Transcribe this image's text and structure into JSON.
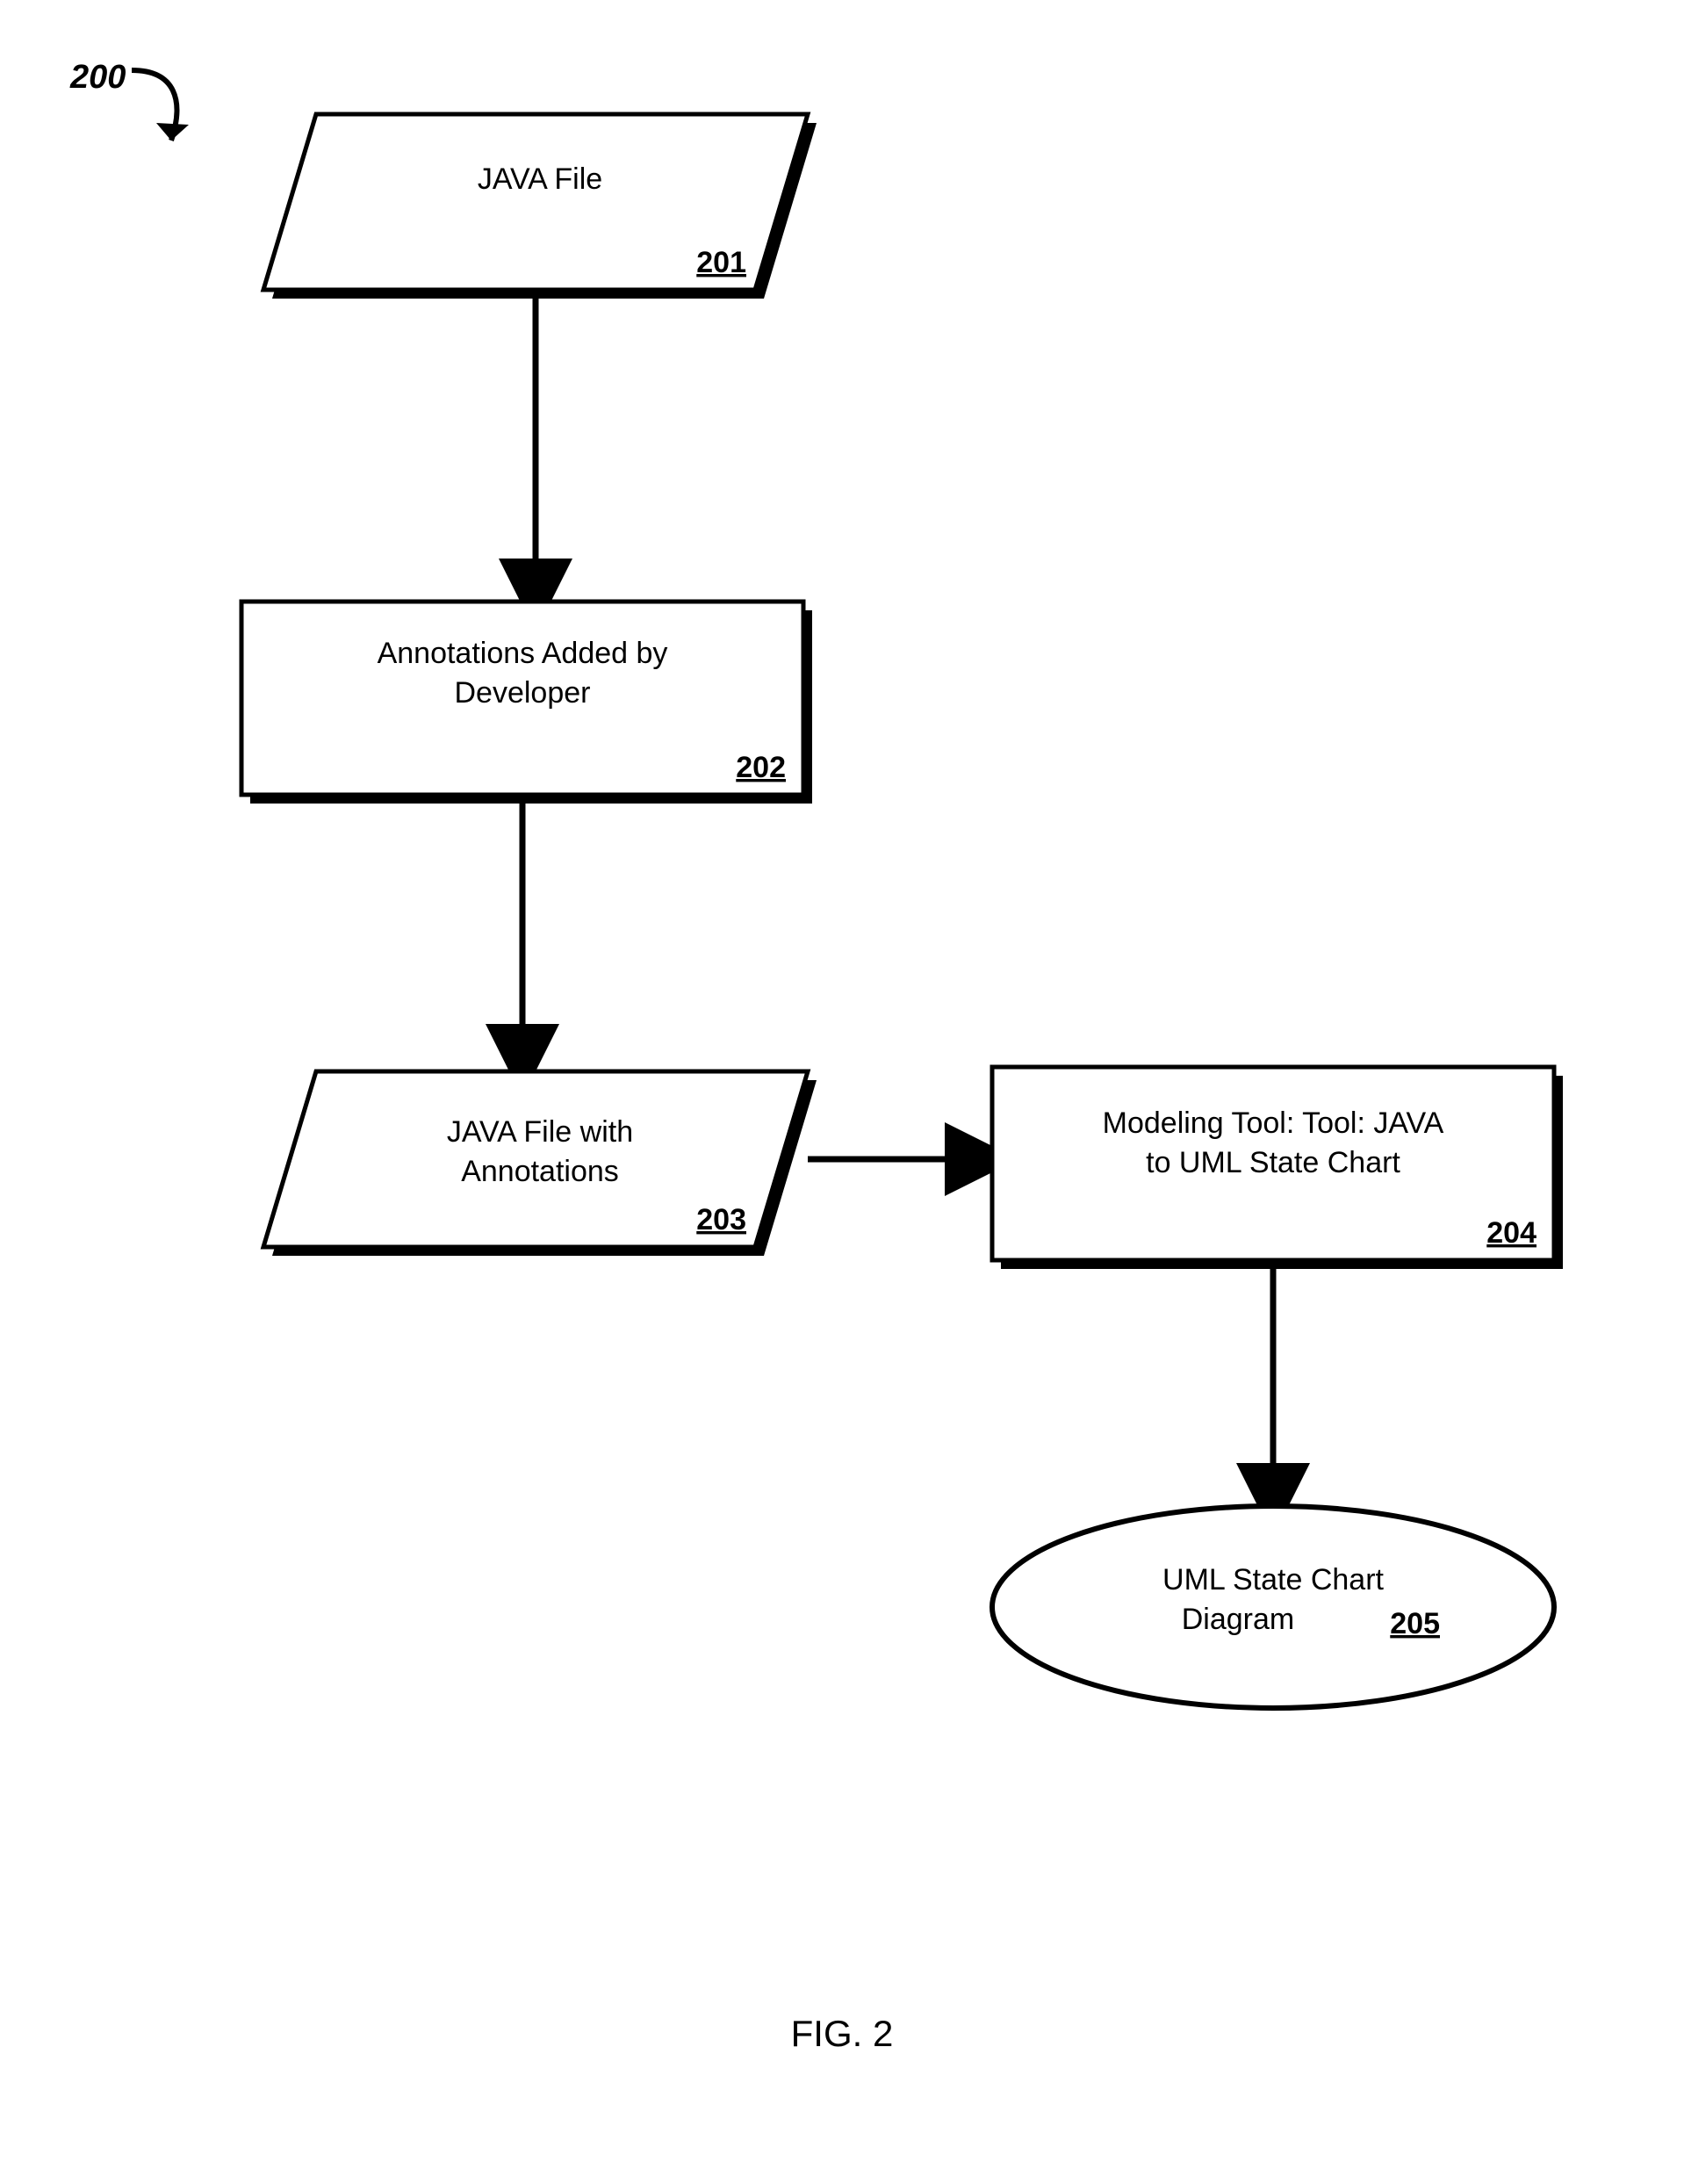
{
  "callout": "200",
  "nodes": {
    "n201": {
      "line1": "JAVA File",
      "ref": "201"
    },
    "n202": {
      "line1": "Annotations Added by",
      "line2": "Developer",
      "ref": "202"
    },
    "n203": {
      "line1": "JAVA File with",
      "line2": "Annotations",
      "ref": "203"
    },
    "n204": {
      "line1": "Modeling Tool: Tool: JAVA",
      "line2": "to UML State Chart",
      "ref": "204"
    },
    "n205": {
      "line1": "UML State Chart",
      "line2": "Diagram",
      "ref": "205"
    }
  },
  "figure": "FIG. 2"
}
